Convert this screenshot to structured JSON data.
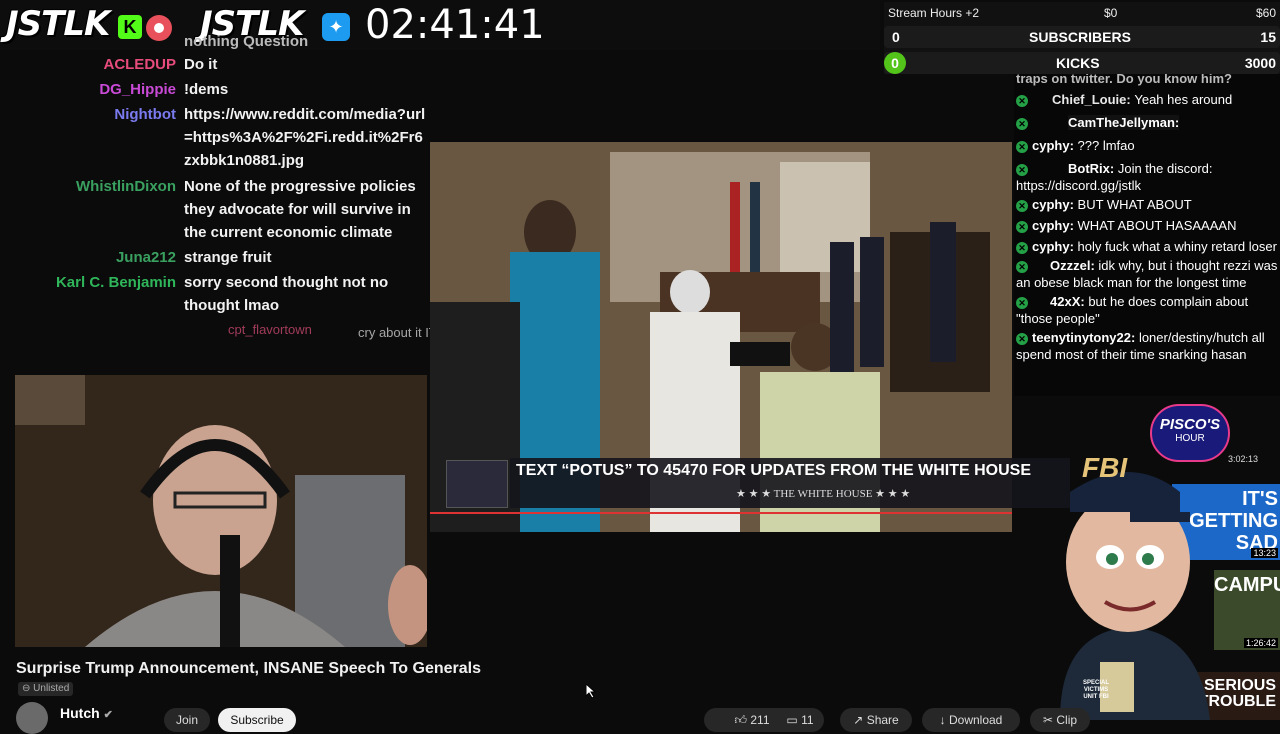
{
  "header": {
    "logo_text_1": "JSTLK",
    "logo_text_2": "JSTLK",
    "kick_badge": "K",
    "clock": "02:41:41"
  },
  "stats": {
    "stream_hours_label": "Stream Hours +2",
    "money_current": "$0",
    "money_goal": "$60",
    "subscribers_current": "0",
    "subscribers_label": "SUBSCRIBERS",
    "subscribers_goal": "15",
    "kicks_current": "0",
    "kicks_label": "KICKS",
    "kicks_goal": "3000"
  },
  "left_chat": {
    "partial_top": "nothing Question",
    "messages": [
      {
        "name": "ACLEDUP",
        "color": "#e74c7c",
        "text": "Do it"
      },
      {
        "name": "DG_Hippie",
        "color": "#c84ad6",
        "text": "!dems"
      },
      {
        "name": "Nightbot",
        "color": "#7b7bf0",
        "text": "https://www.reddit.com/media?url=https%3A%2F%2Fi.redd.it%2Fr6zxbbk1n0881.jpg"
      },
      {
        "name": "WhistlinDixon",
        "color": "#3aa060",
        "text": "None of the progressive policies they advocate for will survive in the current economic climate"
      },
      {
        "name": "Juna212",
        "color": "#3aa060",
        "text": "strange fruit"
      },
      {
        "name": "Karl C. Benjamin",
        "color": "#2fb55a",
        "text": "sorry second thought not no thought lmao"
      },
      {
        "name": "cpt_flavortown",
        "color": "#e0507a",
        "text": "cry about it IT"
      }
    ]
  },
  "video": {
    "lower_third_text": "TEXT “POTUS” TO 45470 FOR UPDATES FROM THE WHITE HOUSE",
    "lower_third_sub": "★ ★ ★  THE WHITE HOUSE  ★ ★ ★"
  },
  "right_chat": {
    "partial_top": "traps on twitter. Do you know him?",
    "messages": [
      {
        "name": "Chief_Louie:",
        "text": "Yeah hes around"
      },
      {
        "name": "CamTheJellyman:",
        "text": ""
      },
      {
        "name": "cyphy:",
        "text": "??? lmfao"
      },
      {
        "name": "BotRix:",
        "text": "Join the discord: https://discord.gg/jstlk"
      },
      {
        "name": "cyphy:",
        "text": "BUT WHAT ABOUT"
      },
      {
        "name": "cyphy:",
        "text": "WHAT ABOUT HASAAAAN"
      },
      {
        "name": "cyphy:",
        "text": "holy fuck what a whiny retard loser"
      },
      {
        "name": "Ozzzel:",
        "text": "idk why, but i thought rezzi was an obese black man for the longest time"
      },
      {
        "name": "42xX:",
        "text": "but he does complain about \"those people\""
      },
      {
        "name": "teenytinytony22:",
        "text": "loner/destiny/hutch all spend most of their time snarking hasan"
      }
    ]
  },
  "overlays": {
    "pisco_text": "PISCO'S",
    "pisco_sub": "HOUR",
    "pisco_time": "3:02:13",
    "fbi_text": "FBI",
    "thumb1_text": "IT'S GETTING SAD",
    "thumb1_time": "13:23",
    "thumb2_text": "CAMPUS",
    "thumb2_time": "1:26:42",
    "thumb3_text": "IN SERIOUS TROUBLE",
    "badge_text": "SPECIAL VICTIMS UNIT FBI"
  },
  "page": {
    "title": "Surprise Trump Announcement, INSANE Speech To Generals",
    "unlisted": "Unlisted",
    "channel": "Hutch",
    "join": "Join",
    "subscribe": "Subscribe",
    "likes": "211",
    "comments": "11",
    "share": "Share",
    "download": "Download",
    "clip": "Clip"
  }
}
